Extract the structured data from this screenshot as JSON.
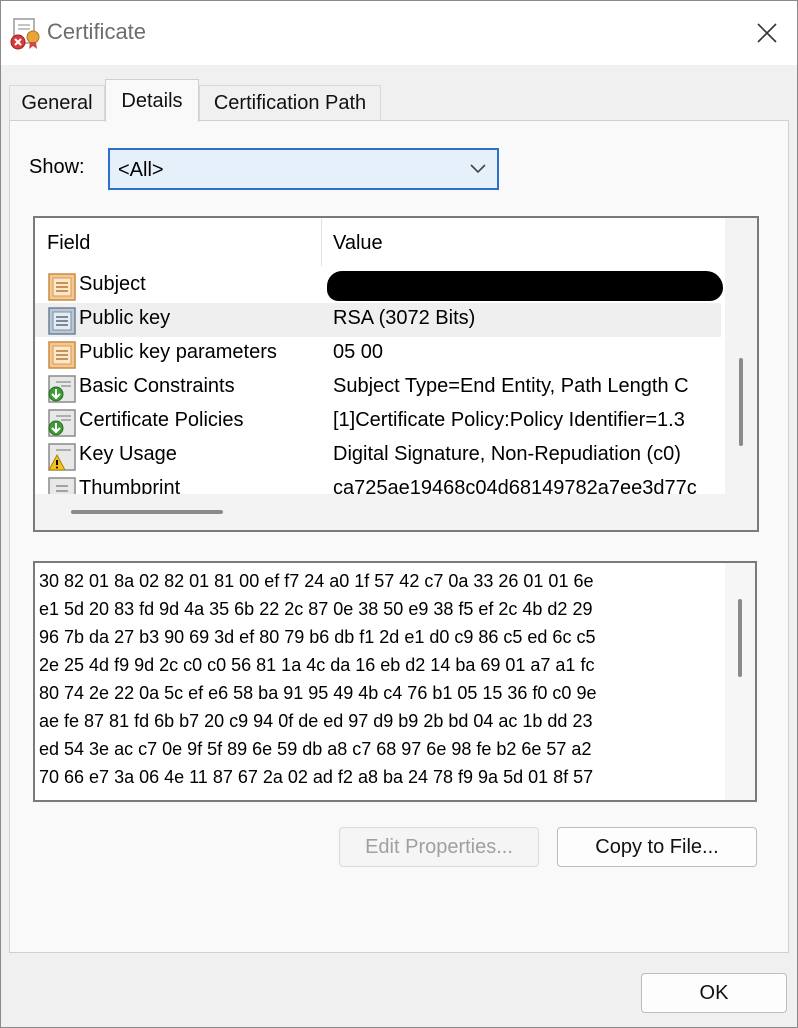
{
  "window": {
    "title": "Certificate",
    "icons": {
      "app": "certificate-error-icon",
      "close": "close-icon"
    }
  },
  "tabs": [
    {
      "label": "General",
      "active": false
    },
    {
      "label": "Details",
      "active": true
    },
    {
      "label": "Certification Path",
      "active": false
    }
  ],
  "show": {
    "label": "Show:",
    "selected": "<All>"
  },
  "list": {
    "headers": {
      "field": "Field",
      "value": "Value"
    },
    "rows": [
      {
        "icon": "certificate-field-icon",
        "field": "Subject",
        "value": "",
        "redacted": true,
        "selected": false
      },
      {
        "icon": "certificate-field-icon",
        "field": "Public key",
        "value": "RSA (3072 Bits)",
        "selected": true
      },
      {
        "icon": "certificate-field-icon",
        "field": "Public key parameters",
        "value": "05 00",
        "selected": false
      },
      {
        "icon": "certificate-extension-icon",
        "field": "Basic Constraints",
        "value": "Subject Type=End Entity, Path Length C",
        "selected": false
      },
      {
        "icon": "certificate-extension-icon",
        "field": "Certificate Policies",
        "value": "[1]Certificate Policy:Policy Identifier=1.3",
        "selected": false
      },
      {
        "icon": "warning-icon",
        "field": "Key Usage",
        "value": "Digital Signature, Non-Repudiation (c0)",
        "selected": false
      },
      {
        "icon": "certificate-field-icon",
        "field": "Thumbprint",
        "value": "ca725ae19468c04d68149782a7ee3d77c",
        "selected": false
      }
    ]
  },
  "hex": {
    "lines": [
      "30 82 01 8a 02 82 01 81 00 ef f7 24 a0 1f 57 42 c7 0a 33 26 01 01 6e",
      "e1 5d 20 83 fd 9d 4a 35 6b 22 2c 87 0e 38 50 e9 38 f5 ef 2c 4b d2 29",
      "96 7b da 27 b3 90 69 3d ef 80 79 b6 db f1 2d e1 d0 c9 86 c5 ed 6c c5",
      "2e 25 4d f9 9d 2c c0 c0 56 81 1a 4c da 16 eb d2 14 ba 69 01 a7 a1 fc",
      "80 74 2e 22 0a 5c ef e6 58 ba 91 95 49 4b c4 76 b1 05 15 36 f0 c0 9e",
      "ae fe 87 81 fd 6b b7 20 c9 94 0f de ed 97 d9 b9 2b bd 04 ac 1b dd 23",
      "ed 54 3e ac c7 0e 9f 5f 89 6e 59 db a8 c7 68 97 6e 98 fe b2 6e 57 a2",
      "70 66 e7 3a 06 4e 11 87 67 2a 02 ad f2 a8 ba 24 78 f9 9a 5d 01 8f 57"
    ]
  },
  "buttons": {
    "edit_properties": "Edit Properties...",
    "copy_to_file": "Copy to File...",
    "ok": "OK"
  },
  "colors": {
    "accent": "#2d6fcc",
    "select_bg": "#e6f0fa"
  }
}
